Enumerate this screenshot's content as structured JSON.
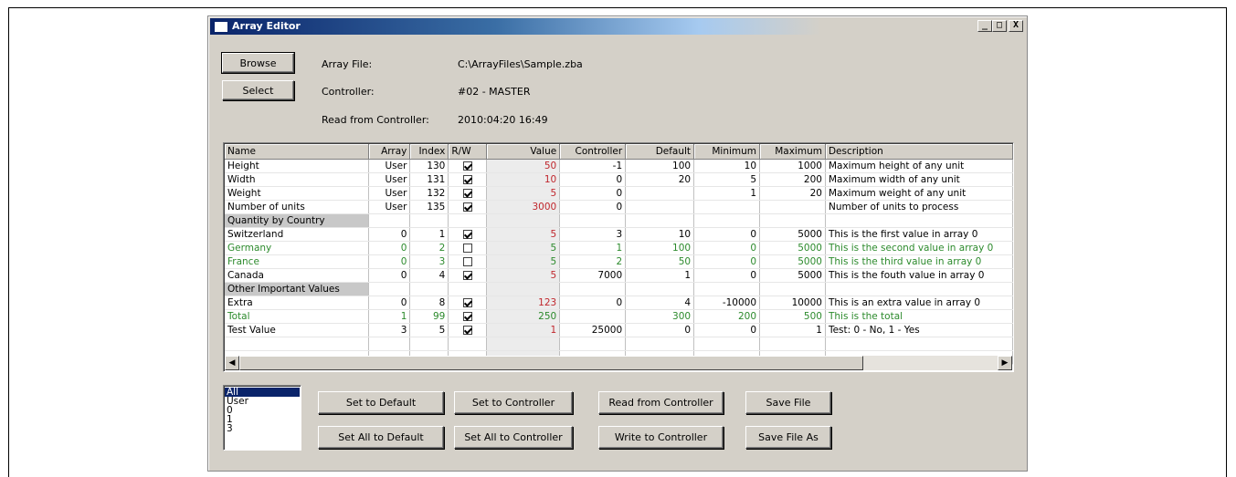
{
  "window": {
    "title": "Array Editor",
    "min": "_",
    "max": "□",
    "close": "X"
  },
  "top": {
    "browse": "Browse",
    "select": "Select",
    "array_file_label": "Array File:",
    "array_file_value": "C:\\ArrayFiles\\Sample.zba",
    "controller_label": "Controller:",
    "controller_value": "#02 - MASTER",
    "read_label": "Read from Controller:",
    "read_value": "2010:04:20 16:49"
  },
  "grid": {
    "columns": [
      "Name",
      "Array",
      "Index",
      "R/W",
      "Value",
      "Controller",
      "Default",
      "Minimum",
      "Maximum",
      "Description"
    ],
    "rows": [
      {
        "type": "row",
        "name": "Height",
        "array": "User",
        "index": "130",
        "rw": true,
        "value": "50",
        "controller": "-1",
        "default": "100",
        "minimum": "10",
        "maximum": "1000",
        "description": "Maximum height of any unit"
      },
      {
        "type": "row",
        "name": "Width",
        "array": "User",
        "index": "131",
        "rw": true,
        "value": "10",
        "controller": "0",
        "default": "20",
        "minimum": "5",
        "maximum": "200",
        "description": "Maximum width of any unit"
      },
      {
        "type": "row",
        "name": "Weight",
        "array": "User",
        "index": "132",
        "rw": true,
        "value": "5",
        "controller": "0",
        "default": "",
        "minimum": "1",
        "maximum": "20",
        "description": "Maximum weight of any unit"
      },
      {
        "type": "row",
        "name": "Number of units",
        "array": "User",
        "index": "135",
        "rw": true,
        "value": "3000",
        "controller": "0",
        "default": "",
        "minimum": "",
        "maximum": "",
        "description": "Number of units to process"
      },
      {
        "type": "group",
        "name": "Quantity by Country"
      },
      {
        "type": "row",
        "name": "Switzerland",
        "array": "0",
        "index": "1",
        "rw": true,
        "value": "5",
        "controller": "3",
        "default": "10",
        "minimum": "0",
        "maximum": "5000",
        "description": "This is the first value in array 0"
      },
      {
        "type": "row",
        "green": true,
        "name": "Germany",
        "array": "0",
        "index": "2",
        "rw": false,
        "value": "5",
        "controller": "1",
        "default": "100",
        "minimum": "0",
        "maximum": "5000",
        "description": "This is the second value in array 0"
      },
      {
        "type": "row",
        "green": true,
        "name": "France",
        "array": "0",
        "index": "3",
        "rw": false,
        "value": "5",
        "controller": "2",
        "default": "50",
        "minimum": "0",
        "maximum": "5000",
        "description": "This is the third value in array 0"
      },
      {
        "type": "row",
        "name": "Canada",
        "array": "0",
        "index": "4",
        "rw": true,
        "value": "5",
        "controller": "7000",
        "default": "1",
        "minimum": "0",
        "maximum": "5000",
        "description": "This is the fouth value in array 0"
      },
      {
        "type": "group",
        "name": "Other Important Values"
      },
      {
        "type": "row",
        "name": "Extra",
        "array": "0",
        "index": "8",
        "rw": true,
        "value": "123",
        "controller": "0",
        "default": "4",
        "minimum": "-10000",
        "maximum": "10000",
        "description": "This is an extra value in array 0"
      },
      {
        "type": "row",
        "green": true,
        "name": "Total",
        "array": "1",
        "index": "99",
        "rw": true,
        "value": "250",
        "controller": "",
        "default": "300",
        "minimum": "200",
        "maximum": "500",
        "description": "This is the total"
      },
      {
        "type": "row",
        "name": "Test Value",
        "array": "3",
        "index": "5",
        "rw": true,
        "value": "1",
        "controller": "25000",
        "default": "0",
        "minimum": "0",
        "maximum": "1",
        "description": "Test: 0 - No, 1 - Yes"
      },
      {
        "type": "empty"
      },
      {
        "type": "empty"
      }
    ]
  },
  "filter": {
    "items": [
      "All",
      "User",
      "0",
      "1",
      "3"
    ],
    "selected": "All"
  },
  "buttons": {
    "set_default": "Set to Default",
    "set_all_default": "Set All to Default",
    "set_controller": "Set to Controller",
    "set_all_controller": "Set All to Controller",
    "read_controller": "Read from Controller",
    "write_controller": "Write to Controller",
    "save_file": "Save File",
    "save_file_as": "Save File As"
  },
  "colors": {
    "value_red": "#c0272d",
    "row_green": "#2c8a2c",
    "title_blue": "#0a246a"
  }
}
